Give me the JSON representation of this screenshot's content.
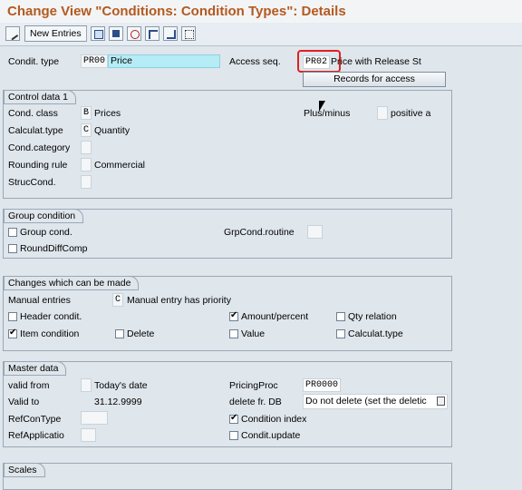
{
  "title": "Change View \"Conditions: Condition Types\": Details",
  "toolbar": {
    "new_entries": "New Entries"
  },
  "header": {
    "condit_type_label": "Condit. type",
    "condit_type_value": "PR00",
    "condit_type_desc": "Price",
    "access_seq_label": "Access seq.",
    "access_seq_value": "PR02",
    "access_seq_desc": "Price with Release St",
    "records_button": "Records for access"
  },
  "control": {
    "heading": "Control data 1",
    "cond_class_label": "Cond. class",
    "cond_class_value": "B",
    "cond_class_desc": "Prices",
    "plus_minus_label": "Plus/minus",
    "plus_minus_desc": "positive a",
    "calculat_label": "Calculat.type",
    "calculat_value": "C",
    "calculat_desc": "Quantity",
    "cond_category_label": "Cond.category",
    "rounding_label": "Rounding rule",
    "rounding_desc": "Commercial",
    "struc_label": "StrucCond."
  },
  "group": {
    "heading": "Group condition",
    "group_cond": "Group cond.",
    "group_cond_checked": false,
    "grp_routine_label": "GrpCond.routine",
    "round_diff": "RoundDiffComp",
    "round_diff_checked": false
  },
  "changes": {
    "heading": "Changes which can be made",
    "manual_label": "Manual entries",
    "manual_value": "C",
    "manual_desc": "Manual entry has priority",
    "header_condit": "Header condit.",
    "header_condit_checked": false,
    "amount_percent": "Amount/percent",
    "amount_percent_checked": true,
    "qty_relation": "Qty relation",
    "qty_relation_checked": false,
    "item_condition": "Item condition",
    "item_condition_checked": true,
    "delete": "Delete",
    "delete_checked": false,
    "value": "Value",
    "value_checked": false,
    "calculat_type": "Calculat.type",
    "calculat_type_checked": false
  },
  "master": {
    "heading": "Master data",
    "valid_from_label": "valid from",
    "valid_from_desc": "Today's date",
    "valid_to_label": "Valid to",
    "valid_to_value": "31.12.9999",
    "pricing_proc_label": "PricingProc",
    "pricing_proc_value": "PR0000",
    "delete_db_label": "delete fr. DB",
    "delete_db_value": "Do not delete (set the deletic",
    "refcontype_label": "RefConType",
    "condition_index": "Condition index",
    "condition_index_checked": true,
    "refapplic_label": "RefApplicatio",
    "condit_update": "Condit.update",
    "condit_update_checked": false
  },
  "scales": {
    "heading": "Scales"
  },
  "colors": {
    "title": "#b35a1f",
    "highlight_field": "#b6ecf6",
    "red_outline": "#e02020"
  }
}
